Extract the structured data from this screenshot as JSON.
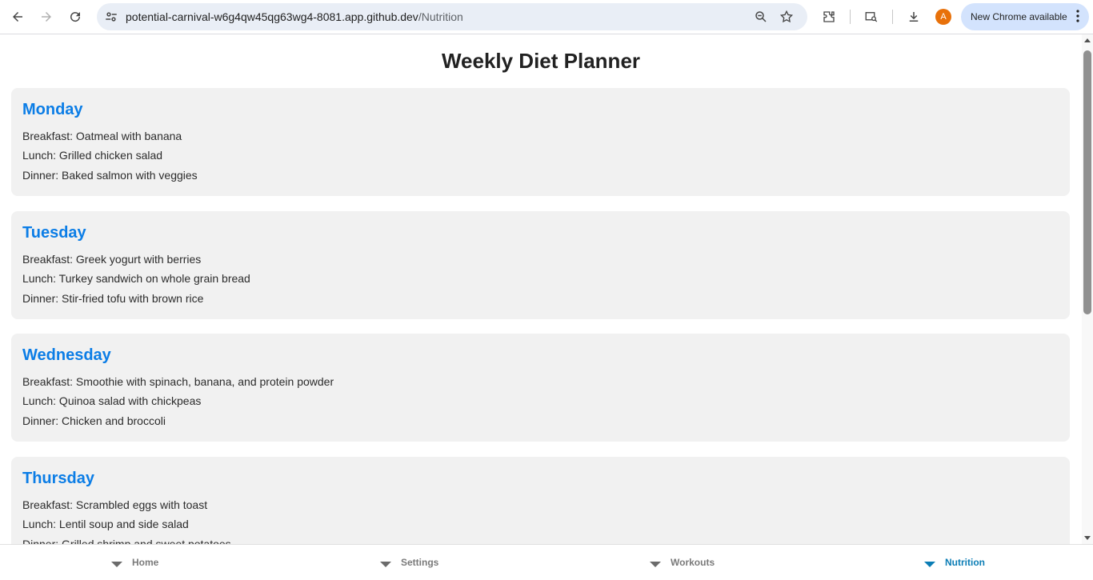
{
  "browser": {
    "url_host": "potential-carnival-w6g4qw45qg63wg4-8081.app.github.dev",
    "url_path": "/Nutrition",
    "profile_initial": "A",
    "update_label": "New Chrome available",
    "colors": {
      "omnibox_bg": "#e9eef6",
      "update_bg": "#d3e3fd",
      "avatar": "#e8710a"
    }
  },
  "page": {
    "title": "Weekly Diet Planner",
    "accent": "#0b7de6",
    "days": [
      {
        "name": "Monday",
        "meals": [
          "Breakfast: Oatmeal with banana",
          "Lunch: Grilled chicken salad",
          "Dinner: Baked salmon with veggies"
        ]
      },
      {
        "name": "Tuesday",
        "meals": [
          "Breakfast: Greek yogurt with berries",
          "Lunch: Turkey sandwich on whole grain bread",
          "Dinner: Stir-fried tofu with brown rice"
        ]
      },
      {
        "name": "Wednesday",
        "meals": [
          "Breakfast: Smoothie with spinach, banana, and protein powder",
          "Lunch: Quinoa salad with chickpeas",
          "Dinner: Chicken and broccoli"
        ]
      },
      {
        "name": "Thursday",
        "meals": [
          "Breakfast: Scrambled eggs with toast",
          "Lunch: Lentil soup and side salad",
          "Dinner: Grilled shrimp and sweet potatoes"
        ]
      }
    ]
  },
  "bottom_nav": {
    "items": [
      {
        "label": "Home",
        "active": false
      },
      {
        "label": "Settings",
        "active": false
      },
      {
        "label": "Workouts",
        "active": false
      },
      {
        "label": "Nutrition",
        "active": true
      }
    ],
    "active_color": "#0b7db5"
  }
}
